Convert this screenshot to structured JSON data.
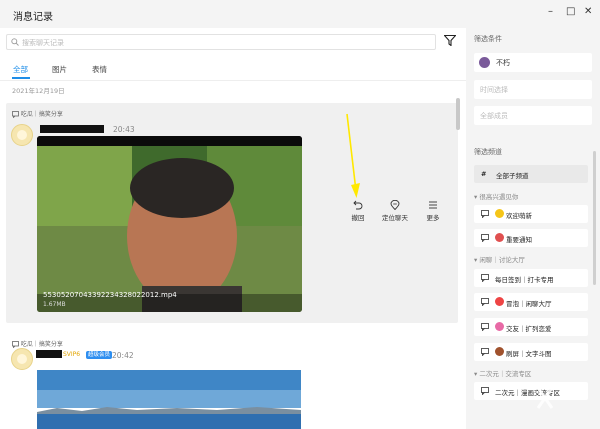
{
  "window": {
    "title": "消息记录",
    "buttons": {
      "minimize": "–",
      "maximize": "□",
      "close": "✕"
    }
  },
  "search": {
    "placeholder": "搜索聊天记录"
  },
  "tabs": [
    {
      "label": "全部",
      "active": true
    },
    {
      "label": "图片",
      "active": false
    },
    {
      "label": "表情",
      "active": false
    }
  ],
  "date_label": "2021年12月19日",
  "messages": [
    {
      "channel": "吃瓜｜搞笑分享",
      "time": "20:43",
      "video": {
        "filename": "5530520704339223432802201​2.mp4",
        "size": "1.67MB"
      }
    },
    {
      "channel": "吃瓜｜搞笑分享",
      "vip": "SVIP6",
      "badge": "超级会员",
      "time": "20:42"
    }
  ],
  "actions": [
    {
      "label": "撤回",
      "icon": "undo-icon"
    },
    {
      "label": "定位聊天",
      "icon": "locate-icon"
    },
    {
      "label": "更多",
      "icon": "menu-icon"
    }
  ],
  "filter_panel": {
    "conditions_label": "筛选条件",
    "user_name": "不朽",
    "time_placeholder": "时间选择",
    "members_placeholder": "全部成员",
    "channels_label": "筛选频道",
    "all_channels": "全部子频道",
    "groups": [
      {
        "name": "很高兴遇见你",
        "channels": [
          {
            "emoji_color": "#f5c518",
            "name": "欢迎萌新"
          },
          {
            "emoji_color": "#e05050",
            "name": "重要通知"
          }
        ]
      },
      {
        "name": "闲聊｜讨论大厅",
        "channels": [
          {
            "emoji_color": "#e44",
            "name": "每日签到｜打卡专用"
          },
          {
            "emoji_color": "#e44",
            "name": "冒泡｜闲聊大厅"
          },
          {
            "emoji_color": "#e86aa6",
            "name": "交友｜扩列恋爱"
          },
          {
            "emoji_color": "#a0522d",
            "name": "刷屏｜文字斗图"
          }
        ]
      },
      {
        "name": "二次元｜交流专区",
        "channels": [
          {
            "emoji_color": "",
            "name": "二次元｜漫画交流专区"
          }
        ]
      }
    ]
  },
  "colors": {
    "accent": "#1e8de8",
    "arrow": "#ffe800"
  }
}
